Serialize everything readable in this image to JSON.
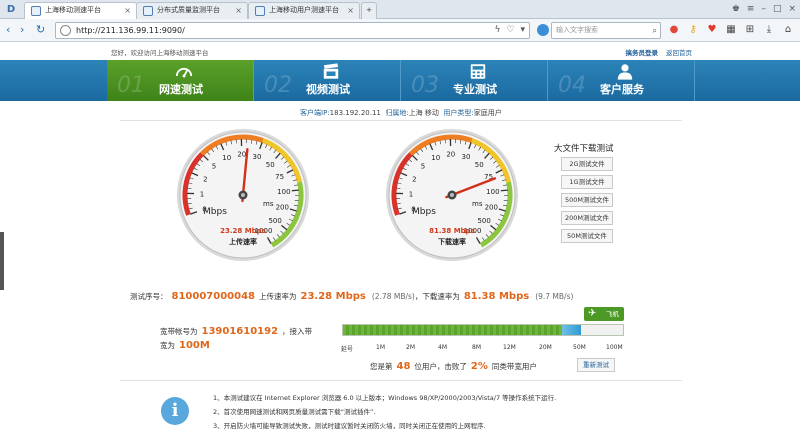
{
  "browser": {
    "tabs": [
      {
        "label": "上海移动测速平台",
        "active": true
      },
      {
        "label": "分布式质量监测平台",
        "active": false
      },
      {
        "label": "上海移动用户测速平台",
        "active": false
      }
    ],
    "url": "http://211.136.99.11:9090/",
    "search_placeholder": "输入文字搜索"
  },
  "site": {
    "welcome": "您好，欢迎访问上海移动测速平台",
    "login": "搞务员登录",
    "back_home": "返回首页"
  },
  "nav": [
    {
      "num": "01",
      "label": "网速测试",
      "icon": "speedometer-icon"
    },
    {
      "num": "02",
      "label": "视频测试",
      "icon": "clapperboard-icon"
    },
    {
      "num": "03",
      "label": "专业测试",
      "icon": "calculator-icon"
    },
    {
      "num": "04",
      "label": "客户服务",
      "icon": "person-icon"
    }
  ],
  "client": {
    "ip_label": "客户端IP:",
    "ip": "183.192.20.11",
    "region_label": "归属地:",
    "region": "上海 移动",
    "type_label": "用户类型:",
    "type": "家庭用户"
  },
  "gauges": {
    "upload": {
      "value": "23.28 Mbps",
      "label": "上传速率",
      "speed": 23.28
    },
    "download": {
      "value": "81.38 Mbps",
      "label": "下载速率",
      "speed": 81.38
    },
    "unit": "Mbps",
    "unit2": "ms",
    "tick_labels": [
      "0",
      "1",
      "2",
      "5",
      "10",
      "20",
      "30",
      "50",
      "75",
      "100",
      "200",
      "500",
      "1000"
    ]
  },
  "downloads": {
    "title": "大文件下载测试",
    "buttons": [
      "2G测试文件",
      "1G测试文件",
      "500M测试文件",
      "200M测试文件",
      "50M测试文件"
    ]
  },
  "result": {
    "seq_label": "测试序号：",
    "seq": "810007000048",
    "up_label": "上传速率为",
    "up": "23.28 Mbps",
    "up_mb": "(2.78 MB/s)",
    "down_label": "，下载速率为",
    "down": "81.38 Mbps",
    "down_mb": "(9.7 MB/s)"
  },
  "bandwidth": {
    "account_label": "宽带帐号为",
    "account": "13901610192",
    "rate_label": "，接入带",
    "rate_label2": "宽为",
    "rate": "100M"
  },
  "speedbar": {
    "badge": "飞机",
    "fill_fraction": 0.85,
    "ticks": [
      "延号",
      "1M",
      "2M",
      "4M",
      "8M",
      "12M",
      "20M",
      "50M",
      "100M"
    ]
  },
  "rank": {
    "prefix": "您是第",
    "position": "48",
    "middle": "位用户，击败了",
    "percent": "2%",
    "suffix": "同类带宽用户"
  },
  "retest": "重新测试",
  "notes": [
    "1、本测试建议在 Internet Explorer 浏览器 6.0 以上版本；Windows 98/XP/2000/2003/Vista/7 等操作系统下运行.",
    "2、首次使用网速测试和网页质量测试需下载“测试插件”.",
    "3、开启防火墙可能导致测试失败，测试时建议暂时关闭防火墙，同时关闭正在使用的上网程序."
  ]
}
